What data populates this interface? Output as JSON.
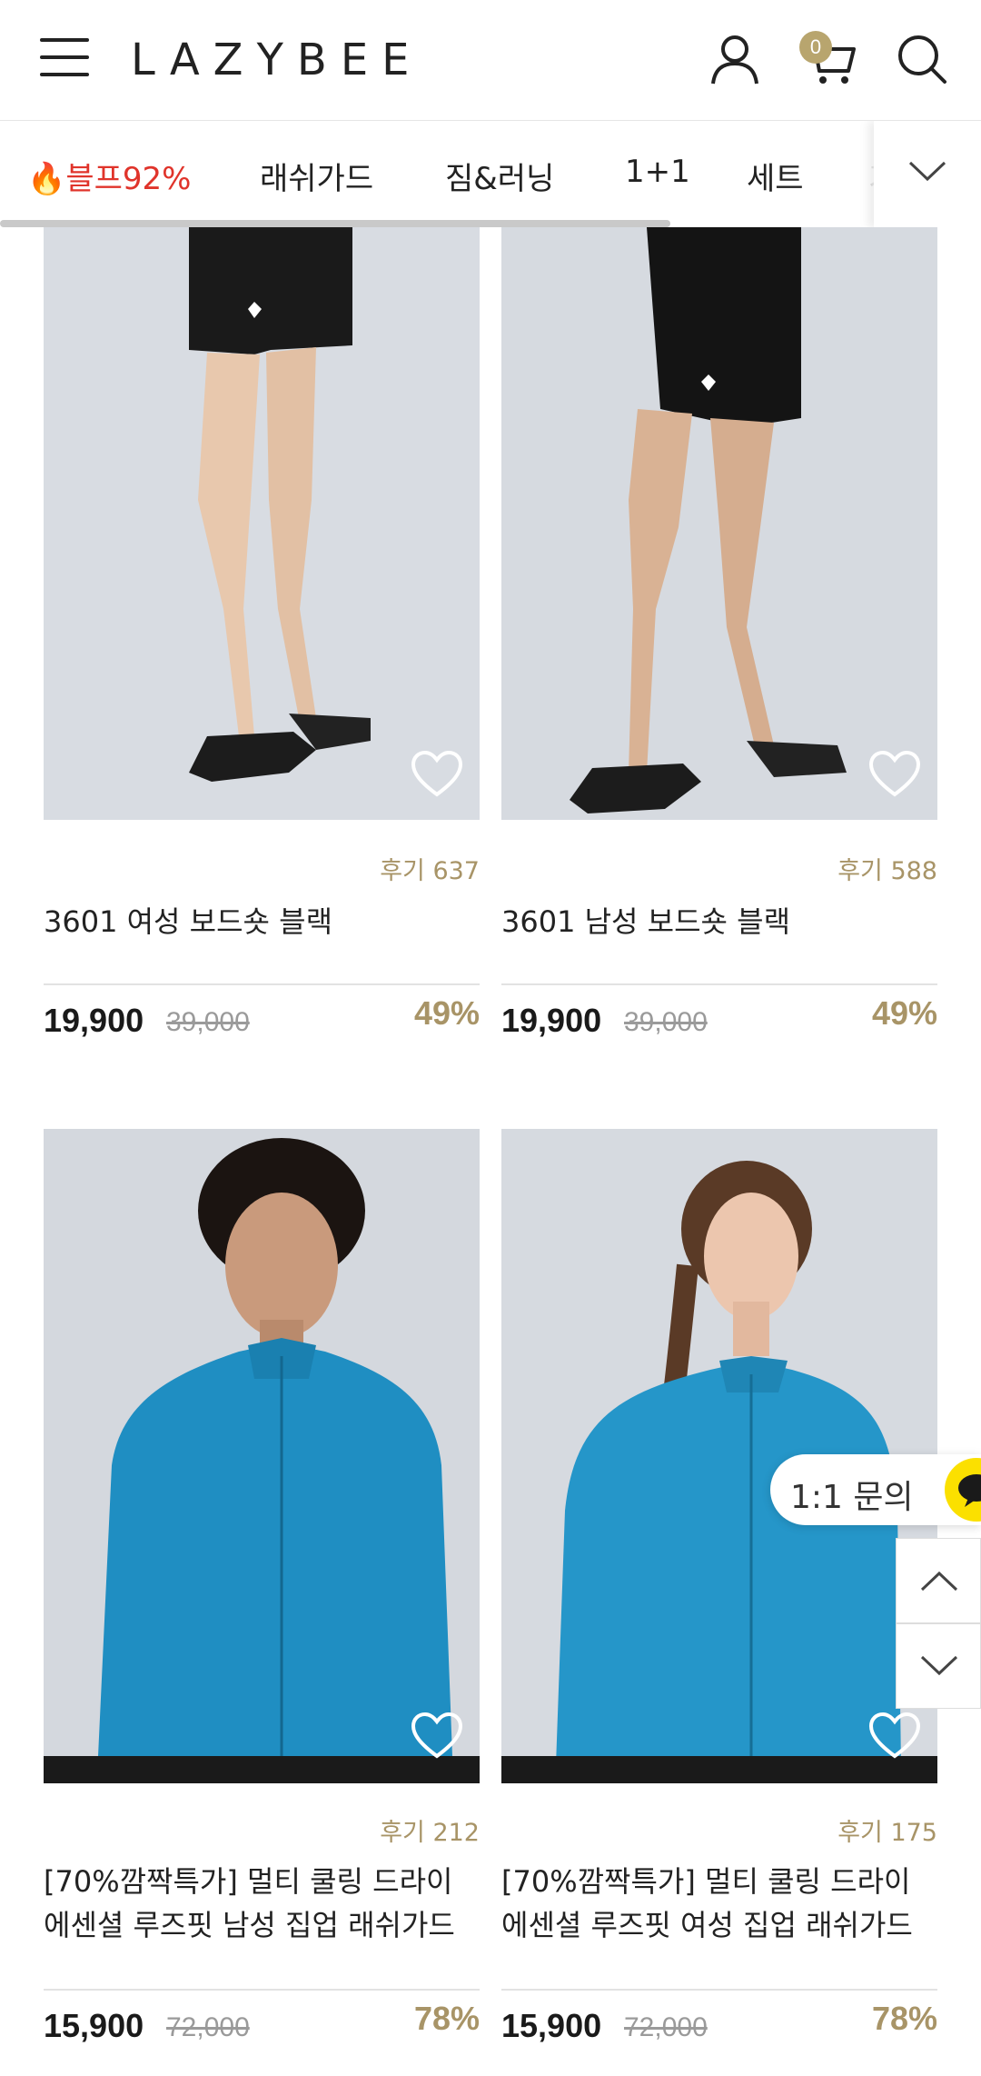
{
  "header": {
    "logo": "LAZYBEE",
    "cart_count": "0"
  },
  "tabs": [
    {
      "label": "🔥블프92%",
      "hot": true
    },
    {
      "label": "래쉬가드"
    },
    {
      "label": "짐&러닝"
    },
    {
      "label": "1+1"
    },
    {
      "label": "세트"
    },
    {
      "label": "기"
    }
  ],
  "products": [
    {
      "reviews": "후기 637",
      "title": "3601 여성 보드숏 블랙",
      "price": "19,900",
      "original_price": "39,000",
      "discount": "49%"
    },
    {
      "reviews": "후기 588",
      "title": "3601 남성 보드숏 블랙",
      "price": "19,900",
      "original_price": "39,000",
      "discount": "49%"
    },
    {
      "reviews": "후기 212",
      "title_line1": "[70%깜짝특가] 멀티 쿨링 드라이",
      "title_line2": "에센셜 루즈핏 남성 집업 래쉬가드",
      "price": "15,900",
      "original_price": "72,000",
      "discount": "78%"
    },
    {
      "reviews": "후기 175",
      "title_line1": "[70%깜짝특가] 멀티 쿨링 드라이",
      "title_line2": "에센셜 루즈핏 여성 집업 래쉬가드",
      "price": "15,900",
      "original_price": "72,000",
      "discount": "78%"
    }
  ],
  "chat": {
    "label": "1:1 문의"
  },
  "colors": {
    "accent": "#a89467",
    "hot": "#e0342b",
    "kakao": "#fbe000",
    "rashguard": "#1f8ec2"
  }
}
